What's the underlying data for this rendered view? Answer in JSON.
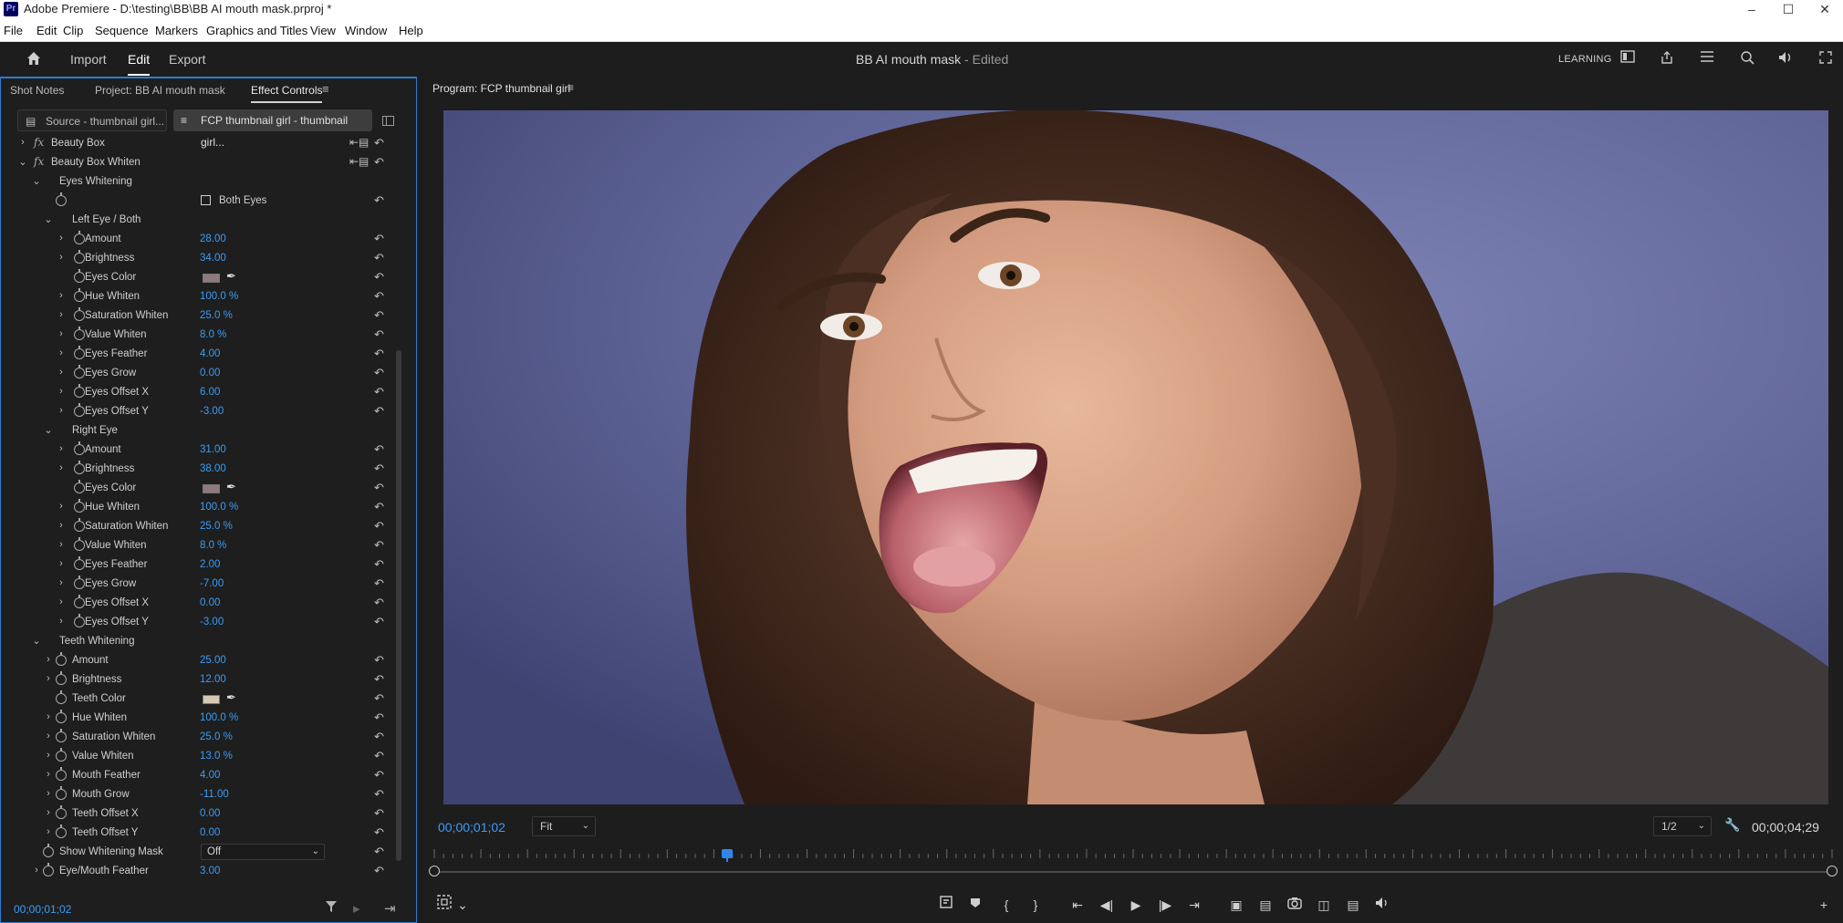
{
  "window": {
    "title": "Adobe Premiere - D:\\testing\\BB\\BB AI mouth mask.prproj *",
    "app_icon": "Pr"
  },
  "menu": [
    "File",
    "Edit",
    "Clip",
    "Sequence",
    "Markers",
    "Graphics and Titles",
    "View",
    "Window",
    "Help"
  ],
  "header": {
    "nav": [
      "Import",
      "Edit",
      "Export"
    ],
    "active_nav": "Edit",
    "project_title": "BB AI mouth mask",
    "edited_suffix": " - Edited",
    "learning": "LEARNING"
  },
  "left_panel": {
    "tabs": [
      "Shot Notes",
      "Project: BB AI mouth mask",
      "Effect Controls"
    ],
    "active_tab": "Effect Controls",
    "source_tab": "Source - thumbnail girl...",
    "sequence_tab": "FCP thumbnail girl - thumbnail girl...",
    "timecode": "00;00;01;02",
    "rows": [
      {
        "indent": 0,
        "chev": ">",
        "fx": true,
        "label": "Beauty Box",
        "addkf": true
      },
      {
        "indent": 0,
        "chev": "v",
        "fx": true,
        "label": "Beauty Box Whiten",
        "addkf": true
      },
      {
        "indent": 1,
        "chev": "v",
        "label": "Eyes Whitening"
      },
      {
        "indent": 2,
        "sw": true,
        "checkbox": "Both Eyes"
      },
      {
        "indent": 2,
        "chev": "v",
        "label": "Left Eye / Both"
      },
      {
        "indent": 3,
        "chev": ">",
        "sw": true,
        "label": "Amount",
        "value": "28.00"
      },
      {
        "indent": 3,
        "chev": ">",
        "sw": true,
        "label": "Brightness",
        "value": "34.00"
      },
      {
        "indent": 3,
        "sw": true,
        "label": "Eyes Color",
        "color": "#8e7a7c"
      },
      {
        "indent": 3,
        "chev": ">",
        "sw": true,
        "label": "Hue Whiten",
        "value": "100.0 %"
      },
      {
        "indent": 3,
        "chev": ">",
        "sw": true,
        "label": "Saturation Whiten",
        "value": "25.0 %"
      },
      {
        "indent": 3,
        "chev": ">",
        "sw": true,
        "label": "Value Whiten",
        "value": "8.0 %"
      },
      {
        "indent": 3,
        "chev": ">",
        "sw": true,
        "label": "Eyes Feather",
        "value": "4.00"
      },
      {
        "indent": 3,
        "chev": ">",
        "sw": true,
        "label": "Eyes Grow",
        "value": "0.00"
      },
      {
        "indent": 3,
        "chev": ">",
        "sw": true,
        "label": "Eyes Offset X",
        "value": "6.00"
      },
      {
        "indent": 3,
        "chev": ">",
        "sw": true,
        "label": "Eyes Offset Y",
        "value": "-3.00"
      },
      {
        "indent": 2,
        "chev": "v",
        "label": "Right Eye"
      },
      {
        "indent": 3,
        "chev": ">",
        "sw": true,
        "label": "Amount",
        "value": "31.00"
      },
      {
        "indent": 3,
        "chev": ">",
        "sw": true,
        "label": "Brightness",
        "value": "38.00"
      },
      {
        "indent": 3,
        "sw": true,
        "label": "Eyes Color",
        "color": "#8e7a7c"
      },
      {
        "indent": 3,
        "chev": ">",
        "sw": true,
        "label": "Hue Whiten",
        "value": "100.0 %"
      },
      {
        "indent": 3,
        "chev": ">",
        "sw": true,
        "label": "Saturation Whiten",
        "value": "25.0 %"
      },
      {
        "indent": 3,
        "chev": ">",
        "sw": true,
        "label": "Value Whiten",
        "value": "8.0 %"
      },
      {
        "indent": 3,
        "chev": ">",
        "sw": true,
        "label": "Eyes Feather",
        "value": "2.00"
      },
      {
        "indent": 3,
        "chev": ">",
        "sw": true,
        "label": "Eyes Grow",
        "value": "-7.00"
      },
      {
        "indent": 3,
        "chev": ">",
        "sw": true,
        "label": "Eyes Offset X",
        "value": "0.00"
      },
      {
        "indent": 3,
        "chev": ">",
        "sw": true,
        "label": "Eyes Offset Y",
        "value": "-3.00"
      },
      {
        "indent": 1,
        "chev": "v",
        "label": "Teeth Whitening"
      },
      {
        "indent": 2,
        "chev": ">",
        "sw": true,
        "label": "Amount",
        "value": "25.00"
      },
      {
        "indent": 2,
        "chev": ">",
        "sw": true,
        "label": "Brightness",
        "value": "12.00"
      },
      {
        "indent": 2,
        "sw": true,
        "label": "Teeth Color",
        "color": "#d6c9b4"
      },
      {
        "indent": 2,
        "chev": ">",
        "sw": true,
        "label": "Hue Whiten",
        "value": "100.0 %"
      },
      {
        "indent": 2,
        "chev": ">",
        "sw": true,
        "label": "Saturation Whiten",
        "value": "25.0 %"
      },
      {
        "indent": 2,
        "chev": ">",
        "sw": true,
        "label": "Value Whiten",
        "value": "13.0 %"
      },
      {
        "indent": 2,
        "chev": ">",
        "sw": true,
        "label": "Mouth Feather",
        "value": "4.00"
      },
      {
        "indent": 2,
        "chev": ">",
        "sw": true,
        "label": "Mouth Grow",
        "value": "-11.00"
      },
      {
        "indent": 2,
        "chev": ">",
        "sw": true,
        "label": "Teeth Offset X",
        "value": "0.00"
      },
      {
        "indent": 2,
        "chev": ">",
        "sw": true,
        "label": "Teeth Offset Y",
        "value": "0.00"
      },
      {
        "indent": 1,
        "sw": true,
        "label": "Show Whitening Mask",
        "dropdown": "Off"
      },
      {
        "indent": 1,
        "chev": ">",
        "sw": true,
        "label": "Eye/Mouth Feather",
        "value": "3.00"
      }
    ]
  },
  "program": {
    "title": "Program: FCP thumbnail girl",
    "timecode": "00;00;01;02",
    "zoom": "Fit",
    "resolution": "1/2",
    "duration": "00;00;04;29",
    "playhead_fraction": 0.21
  },
  "colors": {
    "accent_blue": "#3b9cf5",
    "panel_focus": "#2e7bcf",
    "background": "#1d1d1d"
  }
}
